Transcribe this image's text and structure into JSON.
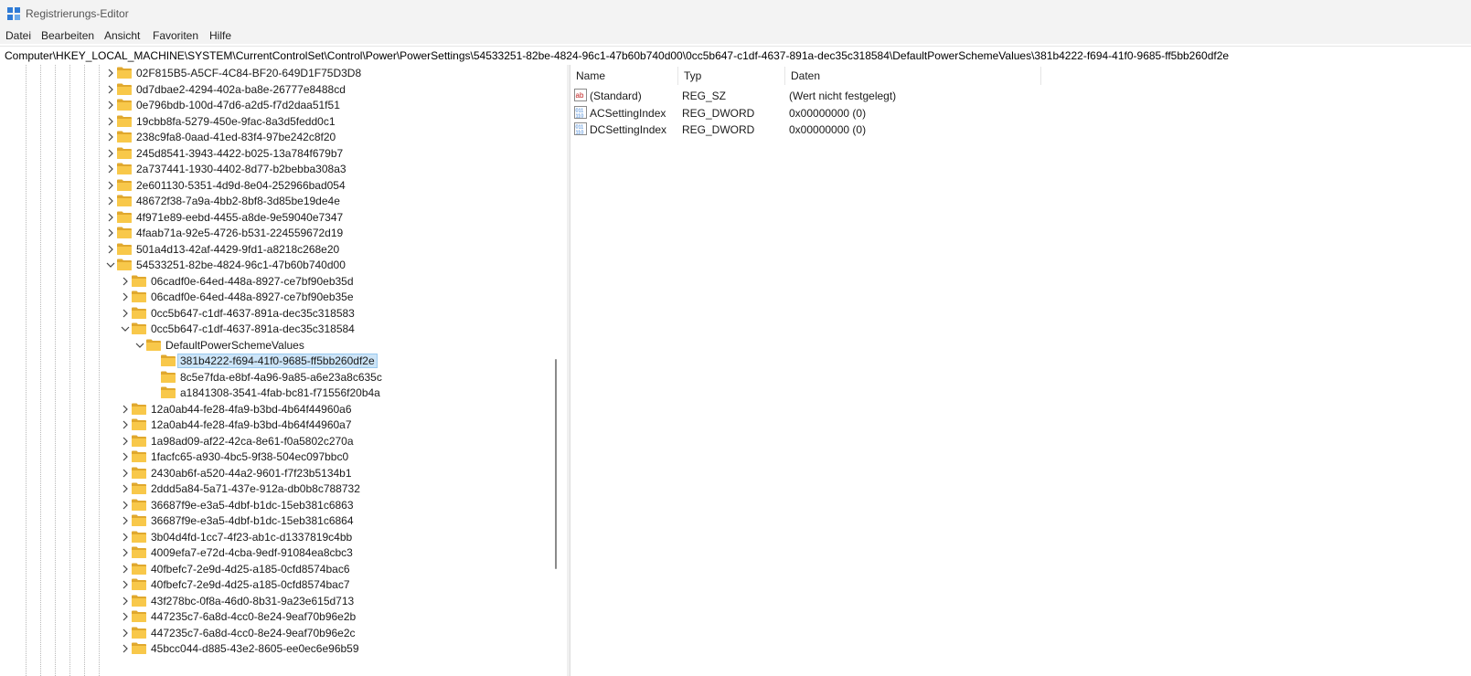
{
  "window": {
    "title": "Registrierungs-Editor"
  },
  "menu": [
    "Datei",
    "Bearbeiten",
    "Ansicht",
    "Favoriten",
    "Hilfe"
  ],
  "address": "Computer\\HKEY_LOCAL_MACHINE\\SYSTEM\\CurrentControlSet\\Control\\Power\\PowerSettings\\54533251-82be-4824-96c1-47b60b740d00\\0cc5b647-c1df-4637-891a-dec35c318584\\DefaultPowerSchemeValues\\381b4222-f694-41f0-9685-ff5bb260df2e",
  "tree": [
    {
      "label": "02F815B5-A5CF-4C84-BF20-649D1F75D3D8",
      "level": 0,
      "state": "collapsed"
    },
    {
      "label": "0d7dbae2-4294-402a-ba8e-26777e8488cd",
      "level": 0,
      "state": "collapsed"
    },
    {
      "label": "0e796bdb-100d-47d6-a2d5-f7d2daa51f51",
      "level": 0,
      "state": "collapsed"
    },
    {
      "label": "19cbb8fa-5279-450e-9fac-8a3d5fedd0c1",
      "level": 0,
      "state": "collapsed"
    },
    {
      "label": "238c9fa8-0aad-41ed-83f4-97be242c8f20",
      "level": 0,
      "state": "collapsed"
    },
    {
      "label": "245d8541-3943-4422-b025-13a784f679b7",
      "level": 0,
      "state": "collapsed"
    },
    {
      "label": "2a737441-1930-4402-8d77-b2bebba308a3",
      "level": 0,
      "state": "collapsed"
    },
    {
      "label": "2e601130-5351-4d9d-8e04-252966bad054",
      "level": 0,
      "state": "collapsed"
    },
    {
      "label": "48672f38-7a9a-4bb2-8bf8-3d85be19de4e",
      "level": 0,
      "state": "collapsed"
    },
    {
      "label": "4f971e89-eebd-4455-a8de-9e59040e7347",
      "level": 0,
      "state": "collapsed"
    },
    {
      "label": "4faab71a-92e5-4726-b531-224559672d19",
      "level": 0,
      "state": "collapsed"
    },
    {
      "label": "501a4d13-42af-4429-9fd1-a8218c268e20",
      "level": 0,
      "state": "collapsed"
    },
    {
      "label": "54533251-82be-4824-96c1-47b60b740d00",
      "level": 0,
      "state": "expanded"
    },
    {
      "label": "06cadf0e-64ed-448a-8927-ce7bf90eb35d",
      "level": 1,
      "state": "collapsed"
    },
    {
      "label": "06cadf0e-64ed-448a-8927-ce7bf90eb35e",
      "level": 1,
      "state": "collapsed"
    },
    {
      "label": "0cc5b647-c1df-4637-891a-dec35c318583",
      "level": 1,
      "state": "collapsed"
    },
    {
      "label": "0cc5b647-c1df-4637-891a-dec35c318584",
      "level": 1,
      "state": "expanded"
    },
    {
      "label": "DefaultPowerSchemeValues",
      "level": 2,
      "state": "expanded"
    },
    {
      "label": "381b4222-f694-41f0-9685-ff5bb260df2e",
      "level": 3,
      "state": "leaf",
      "selected": true
    },
    {
      "label": "8c5e7fda-e8bf-4a96-9a85-a6e23a8c635c",
      "level": 3,
      "state": "leaf"
    },
    {
      "label": "a1841308-3541-4fab-bc81-f71556f20b4a",
      "level": 3,
      "state": "leaf"
    },
    {
      "label": "12a0ab44-fe28-4fa9-b3bd-4b64f44960a6",
      "level": 1,
      "state": "collapsed"
    },
    {
      "label": "12a0ab44-fe28-4fa9-b3bd-4b64f44960a7",
      "level": 1,
      "state": "collapsed"
    },
    {
      "label": "1a98ad09-af22-42ca-8e61-f0a5802c270a",
      "level": 1,
      "state": "collapsed"
    },
    {
      "label": "1facfc65-a930-4bc5-9f38-504ec097bbc0",
      "level": 1,
      "state": "collapsed"
    },
    {
      "label": "2430ab6f-a520-44a2-9601-f7f23b5134b1",
      "level": 1,
      "state": "collapsed"
    },
    {
      "label": "2ddd5a84-5a71-437e-912a-db0b8c788732",
      "level": 1,
      "state": "collapsed"
    },
    {
      "label": "36687f9e-e3a5-4dbf-b1dc-15eb381c6863",
      "level": 1,
      "state": "collapsed"
    },
    {
      "label": "36687f9e-e3a5-4dbf-b1dc-15eb381c6864",
      "level": 1,
      "state": "collapsed"
    },
    {
      "label": "3b04d4fd-1cc7-4f23-ab1c-d1337819c4bb",
      "level": 1,
      "state": "collapsed"
    },
    {
      "label": "4009efa7-e72d-4cba-9edf-91084ea8cbc3",
      "level": 1,
      "state": "collapsed"
    },
    {
      "label": "40fbefc7-2e9d-4d25-a185-0cfd8574bac6",
      "level": 1,
      "state": "collapsed"
    },
    {
      "label": "40fbefc7-2e9d-4d25-a185-0cfd8574bac7",
      "level": 1,
      "state": "collapsed"
    },
    {
      "label": "43f278bc-0f8a-46d0-8b31-9a23e615d713",
      "level": 1,
      "state": "collapsed"
    },
    {
      "label": "447235c7-6a8d-4cc0-8e24-9eaf70b96e2b",
      "level": 1,
      "state": "collapsed"
    },
    {
      "label": "447235c7-6a8d-4cc0-8e24-9eaf70b96e2c",
      "level": 1,
      "state": "collapsed"
    },
    {
      "label": "45bcc044-d885-43e2-8605-ee0ec6e96b59",
      "level": 1,
      "state": "collapsed"
    }
  ],
  "columns": [
    "Name",
    "Typ",
    "Daten"
  ],
  "values": [
    {
      "icon": "string-value-icon",
      "name": "(Standard)",
      "type": "REG_SZ",
      "data": "(Wert nicht festgelegt)"
    },
    {
      "icon": "binary-value-icon",
      "name": "ACSettingIndex",
      "type": "REG_DWORD",
      "data": "0x00000000 (0)"
    },
    {
      "icon": "binary-value-icon",
      "name": "DCSettingIndex",
      "type": "REG_DWORD",
      "data": "0x00000000 (0)"
    }
  ],
  "colors": {
    "selection": "#cce4f7",
    "folder": "#f8c84a",
    "folder_dark": "#e0a82e",
    "accent": "#1e6fd0"
  }
}
